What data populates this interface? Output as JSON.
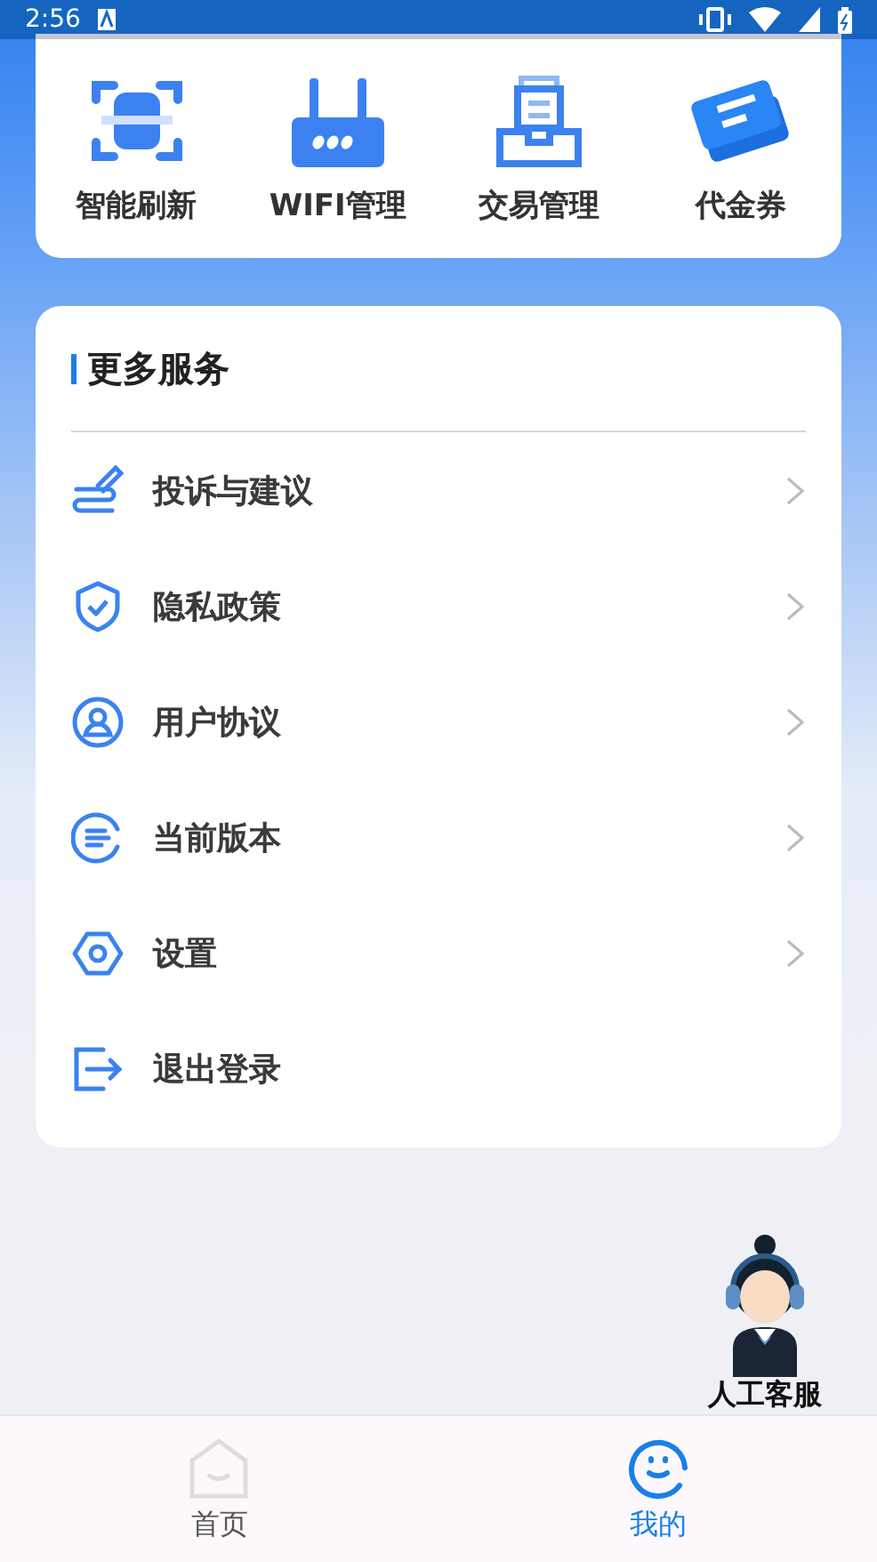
{
  "status_bar": {
    "time": "2:56"
  },
  "quick_actions": [
    {
      "label": "智能刷新"
    },
    {
      "label": "WIFI管理"
    },
    {
      "label": "交易管理"
    },
    {
      "label": "代金券"
    }
  ],
  "services": {
    "title": "更多服务",
    "items": [
      {
        "label": "投诉与建议",
        "kind": "link"
      },
      {
        "label": "隐私政策",
        "kind": "link"
      },
      {
        "label": "用户协议",
        "kind": "link"
      },
      {
        "label": "当前版本",
        "kind": "link"
      },
      {
        "label": "设置",
        "kind": "link"
      },
      {
        "label": "退出登录",
        "kind": "action"
      }
    ]
  },
  "support": {
    "label": "人工客服"
  },
  "bottom_nav": [
    {
      "label": "首页",
      "selected": false
    },
    {
      "label": "我的",
      "selected": true
    }
  ]
}
